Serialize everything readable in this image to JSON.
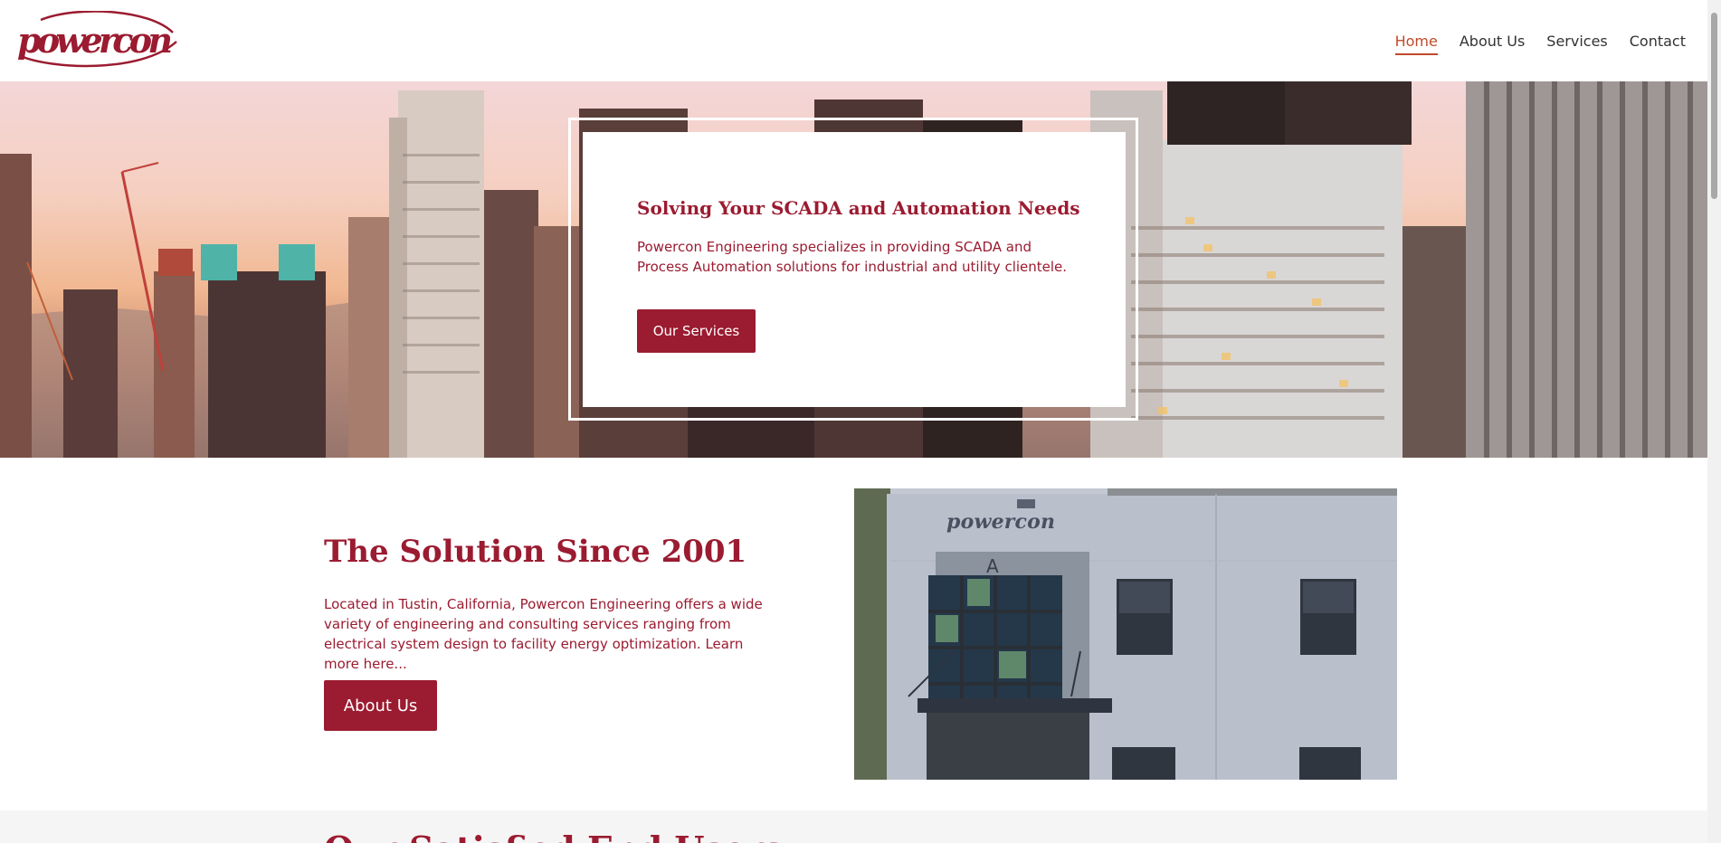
{
  "brand": {
    "name": "powercon",
    "primary_color": "#9b1b30",
    "nav_active_color": "#c04a2b"
  },
  "nav": {
    "items": [
      {
        "label": "Home",
        "active": true
      },
      {
        "label": "About Us",
        "active": false
      },
      {
        "label": "Services",
        "active": false
      },
      {
        "label": "Contact",
        "active": false
      }
    ]
  },
  "hero": {
    "title": "Solving Your SCADA and Automation Needs",
    "text": "Powercon Engineering specializes in providing SCADA and Process Automation solutions for industrial and utility clientele.",
    "button_label": "Our Services",
    "background": "city-skyline-photo"
  },
  "about": {
    "title": "The Solution Since 2001",
    "text": "Located in Tustin, California, Powercon Engineering offers a wide variety of engineering and consulting services ranging from electrical system design to facility energy optimization. Learn more here...",
    "button_label": "About Us",
    "image": "powercon-building-photo",
    "building_sign": "powercon",
    "building_letter": "A"
  },
  "next_section": {
    "title": "Our Satisfied End Users"
  }
}
